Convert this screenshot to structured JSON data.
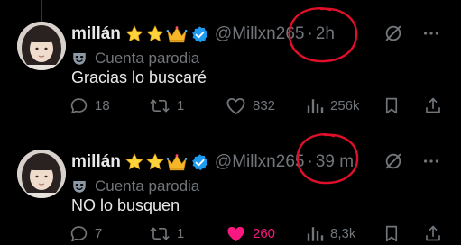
{
  "colors": {
    "background": "#000000",
    "text_primary": "#e7e9ea",
    "text_secondary": "#71767b",
    "verified_blue": "#1d9bf0",
    "like_pink": "#f91880",
    "annotation_red": "#e0102a",
    "star_yellow": "#ffd43b"
  },
  "tweets": [
    {
      "author": {
        "name": "millán",
        "badge_icons": [
          "star-icon",
          "star-icon",
          "crown-icon",
          "verified-badge-icon"
        ],
        "handle": "@Millxn265",
        "separator": "·",
        "time": "2h"
      },
      "parody_label": "Cuenta parodia",
      "text": "Gracias lo buscaré",
      "stats": {
        "replies": "18",
        "reposts": "1",
        "likes": "832",
        "views": "256k",
        "liked": false
      }
    },
    {
      "author": {
        "name": "millán",
        "badge_icons": [
          "star-icon",
          "star-icon",
          "crown-icon",
          "verified-badge-icon"
        ],
        "handle": "@Millxn265",
        "separator": "·",
        "time": "39 m"
      },
      "parody_label": "Cuenta parodia",
      "text": "NO lo busquen",
      "stats": {
        "replies": "7",
        "reposts": "1",
        "likes": "260",
        "views": "8,3k",
        "liked": true
      }
    }
  ]
}
